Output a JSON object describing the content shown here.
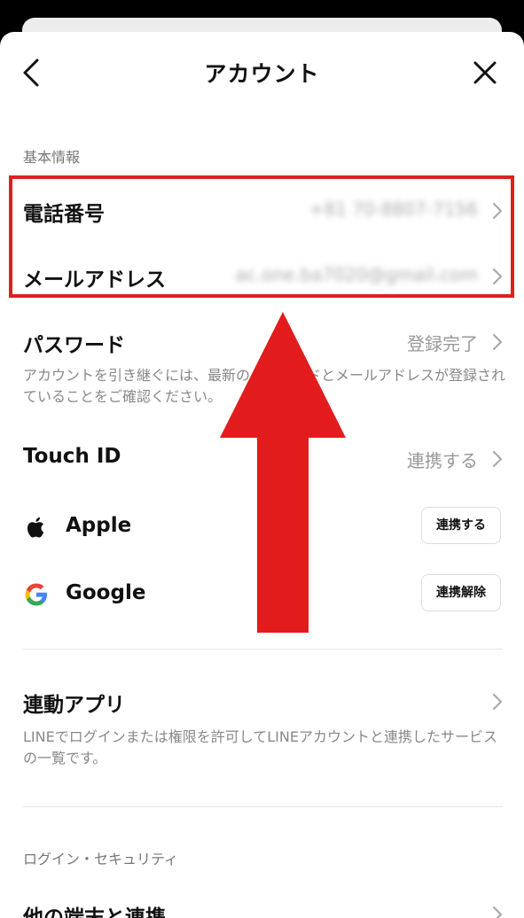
{
  "header": {
    "title": "アカウント"
  },
  "basic": {
    "section_label": "基本情報",
    "phone": {
      "label": "電話番号",
      "value": "+81 70-8807-7156"
    },
    "email": {
      "label": "メールアドレス",
      "value": "ac.one.ba7020@gmail.com"
    },
    "password": {
      "label": "パスワード",
      "value": "登録完了",
      "description": "アカウントを引き継ぐには、最新のパスワードとメールアドレスが登録されていることをご確認ください。"
    },
    "touch_id": {
      "label": "Touch ID",
      "value": "連携する"
    },
    "apple": {
      "label": "Apple",
      "button": "連携する",
      "icon": "apple-icon"
    },
    "google": {
      "label": "Google",
      "button": "連携解除",
      "icon": "google-icon"
    }
  },
  "linked_apps": {
    "label": "連動アプリ",
    "description": "LINEでログインまたは権限を許可してLINEアカウントと連携したサービスの一覧です。"
  },
  "security": {
    "section_label": "ログイン・セキュリティ",
    "row_label": "他の端末と連携"
  },
  "colors": {
    "accent_red": "#e02020",
    "google_blue": "#4285F4",
    "google_red": "#EA4335",
    "google_yellow": "#FBBC05",
    "google_green": "#34A853"
  }
}
